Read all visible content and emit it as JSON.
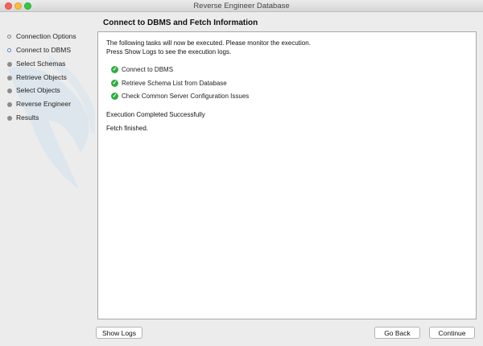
{
  "window": {
    "title": "Reverse Engineer Database"
  },
  "sidebar": {
    "steps": [
      {
        "label": "Connection Options",
        "state": "done"
      },
      {
        "label": "Connect to DBMS",
        "state": "current"
      },
      {
        "label": "Select Schemas",
        "state": "pending"
      },
      {
        "label": "Retrieve Objects",
        "state": "pending"
      },
      {
        "label": "Select Objects",
        "state": "pending"
      },
      {
        "label": "Reverse Engineer",
        "state": "pending"
      },
      {
        "label": "Results",
        "state": "pending"
      }
    ]
  },
  "main": {
    "heading": "Connect to DBMS and Fetch Information",
    "intro_line1": "The following tasks will now be executed. Please monitor the execution.",
    "intro_line2": "Press Show Logs to see the execution logs.",
    "tasks": [
      {
        "label": "Connect to DBMS",
        "status": "completed"
      },
      {
        "label": "Retrieve Schema List from Database",
        "status": "completed"
      },
      {
        "label": "Check Common Server Configuration Issues",
        "status": "completed"
      }
    ],
    "status_message": "Execution Completed Successfully",
    "fetch_message": "Fetch finished."
  },
  "buttons": {
    "show_logs": "Show Logs",
    "go_back": "Go Back",
    "continue": "Continue"
  },
  "colors": {
    "check_green": "#2fae3f",
    "current_step_ring": "#5a86c9"
  }
}
